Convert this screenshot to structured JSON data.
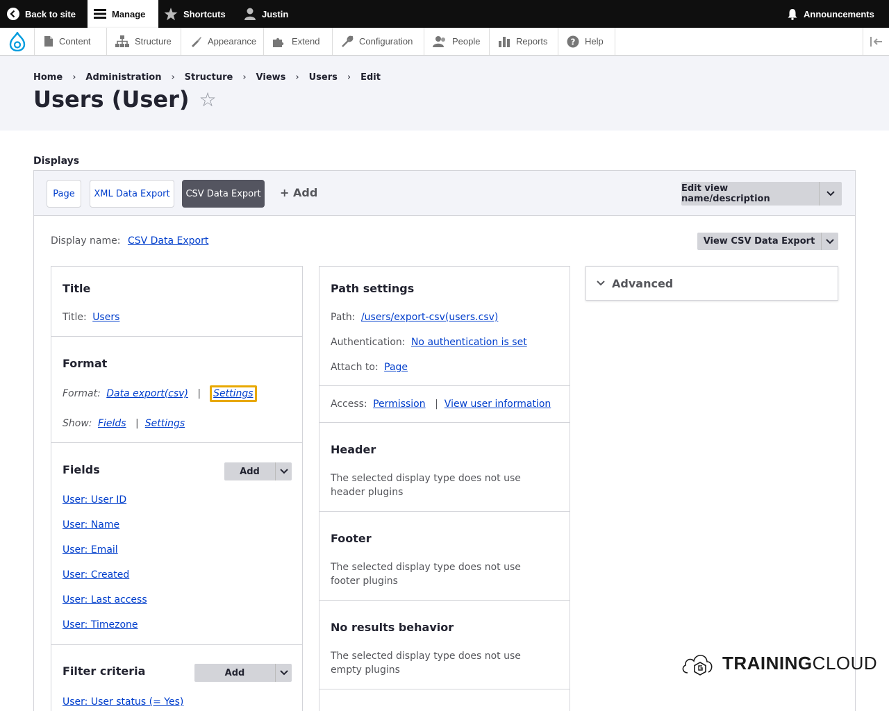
{
  "toolbar": {
    "back": "Back to site",
    "manage": "Manage",
    "shortcuts": "Shortcuts",
    "user": "Justin",
    "announcements": "Announcements"
  },
  "admin_menu": [
    "Content",
    "Structure",
    "Appearance",
    "Extend",
    "Configuration",
    "People",
    "Reports",
    "Help"
  ],
  "breadcrumb": [
    "Home",
    "Administration",
    "Structure",
    "Views",
    "Users",
    "Edit"
  ],
  "page_title": "Users (User)",
  "displays": {
    "label": "Displays",
    "tabs": [
      "Page",
      "XML Data Export",
      "CSV Data Export"
    ],
    "active_tab": "CSV Data Export",
    "add": "+ Add",
    "edit_button": "Edit view name/description"
  },
  "display_name": {
    "label": "Display name:",
    "value": "CSV Data Export",
    "view_button": "View CSV Data Export"
  },
  "title_section": {
    "heading": "Title",
    "label": "Title:",
    "value": "Users"
  },
  "format_section": {
    "heading": "Format",
    "format_label": "Format:",
    "format_value": "Data export(csv)",
    "format_settings": "Settings",
    "show_label": "Show:",
    "show_value": "Fields",
    "show_settings": "Settings"
  },
  "fields_section": {
    "heading": "Fields",
    "add": "Add",
    "items": [
      "User: User ID",
      "User: Name",
      "User: Email",
      "User: Created",
      "User: Last access",
      "User: Timezone"
    ]
  },
  "filter_section": {
    "heading": "Filter criteria",
    "add": "Add",
    "items": [
      "User: User status (= Yes)"
    ]
  },
  "path_section": {
    "heading": "Path settings",
    "path_label": "Path:",
    "path_value": "/users/export-csv(users.csv)",
    "auth_label": "Authentication:",
    "auth_value": "No authentication is set",
    "attach_label": "Attach to:",
    "attach_value": "Page"
  },
  "access": {
    "label": "Access:",
    "permission": "Permission",
    "value": "View user information"
  },
  "header_section": {
    "heading": "Header",
    "text": "The selected display type does not use header plugins"
  },
  "footer_section": {
    "heading": "Footer",
    "text": "The selected display type does not use footer plugins"
  },
  "noresults_section": {
    "heading": "No results behavior",
    "text": "The selected display type does not use empty plugins"
  },
  "advanced": "Advanced",
  "watermark": {
    "bold": "TRAINING",
    "light": "CLOUD"
  }
}
